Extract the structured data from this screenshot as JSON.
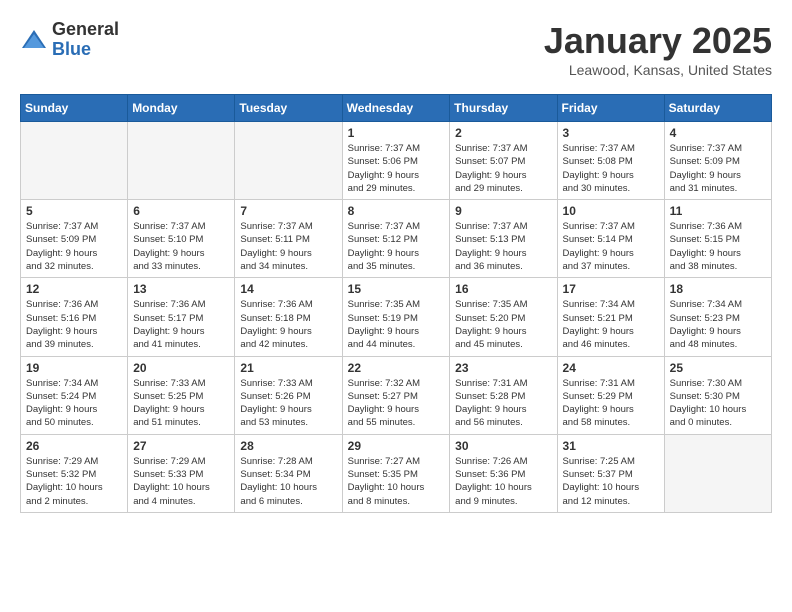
{
  "logo": {
    "general": "General",
    "blue": "Blue"
  },
  "title": "January 2025",
  "location": "Leawood, Kansas, United States",
  "weekdays": [
    "Sunday",
    "Monday",
    "Tuesday",
    "Wednesday",
    "Thursday",
    "Friday",
    "Saturday"
  ],
  "weeks": [
    [
      {
        "day": "",
        "info": "",
        "empty": true
      },
      {
        "day": "",
        "info": "",
        "empty": true
      },
      {
        "day": "",
        "info": "",
        "empty": true
      },
      {
        "day": "1",
        "info": "Sunrise: 7:37 AM\nSunset: 5:06 PM\nDaylight: 9 hours\nand 29 minutes."
      },
      {
        "day": "2",
        "info": "Sunrise: 7:37 AM\nSunset: 5:07 PM\nDaylight: 9 hours\nand 29 minutes."
      },
      {
        "day": "3",
        "info": "Sunrise: 7:37 AM\nSunset: 5:08 PM\nDaylight: 9 hours\nand 30 minutes."
      },
      {
        "day": "4",
        "info": "Sunrise: 7:37 AM\nSunset: 5:09 PM\nDaylight: 9 hours\nand 31 minutes."
      }
    ],
    [
      {
        "day": "5",
        "info": "Sunrise: 7:37 AM\nSunset: 5:09 PM\nDaylight: 9 hours\nand 32 minutes."
      },
      {
        "day": "6",
        "info": "Sunrise: 7:37 AM\nSunset: 5:10 PM\nDaylight: 9 hours\nand 33 minutes."
      },
      {
        "day": "7",
        "info": "Sunrise: 7:37 AM\nSunset: 5:11 PM\nDaylight: 9 hours\nand 34 minutes."
      },
      {
        "day": "8",
        "info": "Sunrise: 7:37 AM\nSunset: 5:12 PM\nDaylight: 9 hours\nand 35 minutes."
      },
      {
        "day": "9",
        "info": "Sunrise: 7:37 AM\nSunset: 5:13 PM\nDaylight: 9 hours\nand 36 minutes."
      },
      {
        "day": "10",
        "info": "Sunrise: 7:37 AM\nSunset: 5:14 PM\nDaylight: 9 hours\nand 37 minutes."
      },
      {
        "day": "11",
        "info": "Sunrise: 7:36 AM\nSunset: 5:15 PM\nDaylight: 9 hours\nand 38 minutes."
      }
    ],
    [
      {
        "day": "12",
        "info": "Sunrise: 7:36 AM\nSunset: 5:16 PM\nDaylight: 9 hours\nand 39 minutes."
      },
      {
        "day": "13",
        "info": "Sunrise: 7:36 AM\nSunset: 5:17 PM\nDaylight: 9 hours\nand 41 minutes."
      },
      {
        "day": "14",
        "info": "Sunrise: 7:36 AM\nSunset: 5:18 PM\nDaylight: 9 hours\nand 42 minutes."
      },
      {
        "day": "15",
        "info": "Sunrise: 7:35 AM\nSunset: 5:19 PM\nDaylight: 9 hours\nand 44 minutes."
      },
      {
        "day": "16",
        "info": "Sunrise: 7:35 AM\nSunset: 5:20 PM\nDaylight: 9 hours\nand 45 minutes."
      },
      {
        "day": "17",
        "info": "Sunrise: 7:34 AM\nSunset: 5:21 PM\nDaylight: 9 hours\nand 46 minutes."
      },
      {
        "day": "18",
        "info": "Sunrise: 7:34 AM\nSunset: 5:23 PM\nDaylight: 9 hours\nand 48 minutes."
      }
    ],
    [
      {
        "day": "19",
        "info": "Sunrise: 7:34 AM\nSunset: 5:24 PM\nDaylight: 9 hours\nand 50 minutes."
      },
      {
        "day": "20",
        "info": "Sunrise: 7:33 AM\nSunset: 5:25 PM\nDaylight: 9 hours\nand 51 minutes."
      },
      {
        "day": "21",
        "info": "Sunrise: 7:33 AM\nSunset: 5:26 PM\nDaylight: 9 hours\nand 53 minutes."
      },
      {
        "day": "22",
        "info": "Sunrise: 7:32 AM\nSunset: 5:27 PM\nDaylight: 9 hours\nand 55 minutes."
      },
      {
        "day": "23",
        "info": "Sunrise: 7:31 AM\nSunset: 5:28 PM\nDaylight: 9 hours\nand 56 minutes."
      },
      {
        "day": "24",
        "info": "Sunrise: 7:31 AM\nSunset: 5:29 PM\nDaylight: 9 hours\nand 58 minutes."
      },
      {
        "day": "25",
        "info": "Sunrise: 7:30 AM\nSunset: 5:30 PM\nDaylight: 10 hours\nand 0 minutes."
      }
    ],
    [
      {
        "day": "26",
        "info": "Sunrise: 7:29 AM\nSunset: 5:32 PM\nDaylight: 10 hours\nand 2 minutes."
      },
      {
        "day": "27",
        "info": "Sunrise: 7:29 AM\nSunset: 5:33 PM\nDaylight: 10 hours\nand 4 minutes."
      },
      {
        "day": "28",
        "info": "Sunrise: 7:28 AM\nSunset: 5:34 PM\nDaylight: 10 hours\nand 6 minutes."
      },
      {
        "day": "29",
        "info": "Sunrise: 7:27 AM\nSunset: 5:35 PM\nDaylight: 10 hours\nand 8 minutes."
      },
      {
        "day": "30",
        "info": "Sunrise: 7:26 AM\nSunset: 5:36 PM\nDaylight: 10 hours\nand 9 minutes."
      },
      {
        "day": "31",
        "info": "Sunrise: 7:25 AM\nSunset: 5:37 PM\nDaylight: 10 hours\nand 12 minutes."
      },
      {
        "day": "",
        "info": "",
        "empty": true
      }
    ]
  ]
}
